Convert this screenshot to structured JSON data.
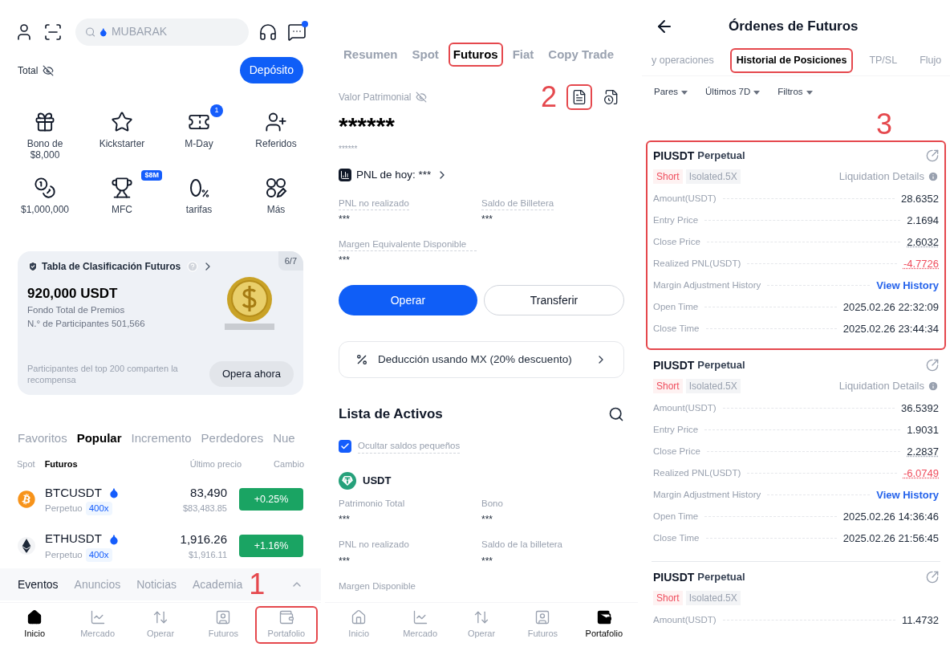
{
  "home": {
    "search": {
      "placeholder": "MUBARAK"
    },
    "total": "Total",
    "deposit": "Depósito",
    "shortcuts": [
      {
        "kind": "gift",
        "label": "Bono de $8,000"
      },
      {
        "kind": "star",
        "label": "Kickstarter"
      },
      {
        "kind": "ticket",
        "label": "M-Day",
        "badge": {
          "kind": "dot",
          "text": "1"
        }
      },
      {
        "kind": "referral",
        "label": "Referidos"
      },
      {
        "kind": "coins",
        "label": "$1,000,000"
      },
      {
        "kind": "trophy",
        "label": "MFC",
        "badge": {
          "kind": "tag",
          "text": "$8M"
        }
      },
      {
        "kind": "zero-fee",
        "label": "tarifas"
      },
      {
        "kind": "more",
        "label": "Más"
      }
    ],
    "leaderboard": {
      "title": "Tabla de Clasificación Futuros",
      "pager": "6/7",
      "amount": "920,000 USDT",
      "subtitle": "Fondo Total de Premios",
      "participants": "N.° de Participantes 501,566",
      "note": "Participantes del top 200 comparten la recompensa",
      "button": "Opera ahora"
    },
    "market_tabs": [
      {
        "label": "Favoritos",
        "selected": false
      },
      {
        "label": "Popular",
        "selected": true
      },
      {
        "label": "Incremento",
        "selected": false
      },
      {
        "label": "Perdedores",
        "selected": false
      },
      {
        "label": "Nue",
        "selected": false
      }
    ],
    "market_type_tabs": [
      {
        "label": "Spot",
        "selected": false
      },
      {
        "label": "Futuros",
        "selected": true
      }
    ],
    "columns": [
      "Último precio",
      "Cambio"
    ],
    "rows": [
      {
        "kind": "btc",
        "symbol": "BTCUSDT",
        "type": "Perpetuo",
        "leverage": "400x",
        "price": "83,490",
        "fiat_price": "$83,483.85",
        "change": "+0.25%"
      },
      {
        "kind": "eth",
        "symbol": "ETHUSDT",
        "type": "Perpetuo",
        "leverage": "400x",
        "price": "1,916.26",
        "fiat_price": "$1,916.11",
        "change": "+1.16%"
      }
    ],
    "news_tabs": [
      {
        "label": "Eventos",
        "selected": true
      },
      {
        "label": "Anuncios",
        "selected": false
      },
      {
        "label": "Noticias",
        "selected": false
      },
      {
        "label": "Academia",
        "selected": false
      }
    ],
    "marker": "1",
    "nav": [
      {
        "kind": "home",
        "label": "Inicio",
        "selected": true,
        "highlighted": false
      },
      {
        "kind": "market",
        "label": "Mercado",
        "selected": false,
        "highlighted": false
      },
      {
        "kind": "trade",
        "label": "Operar",
        "selected": false,
        "highlighted": false
      },
      {
        "kind": "futures",
        "label": "Futuros",
        "selected": false,
        "highlighted": false
      },
      {
        "kind": "portfolio",
        "label": "Portafolio",
        "selected": false,
        "highlighted": true
      }
    ]
  },
  "portfolio": {
    "tabs": [
      {
        "label": "Resumen",
        "selected": false,
        "highlighted": false
      },
      {
        "label": "Spot",
        "selected": false,
        "highlighted": false
      },
      {
        "label": "Futuros",
        "selected": true,
        "highlighted": true
      },
      {
        "label": "Fiat",
        "selected": false,
        "highlighted": false
      },
      {
        "label": "Copy Trade",
        "selected": false,
        "highlighted": false
      }
    ],
    "equity_label": "Valor Patrimonial",
    "marker": "2",
    "actions": [
      {
        "kind": "orders",
        "highlighted": true
      },
      {
        "kind": "history",
        "highlighted": false
      }
    ],
    "equity": "******",
    "equity_sub": "******",
    "pnl_today": "PNL de hoy: ***",
    "stats": [
      {
        "label": "PNL no realizado",
        "value": "***"
      },
      {
        "label": "Saldo de Billetera",
        "value": "***"
      },
      {
        "label": "Margen Equivalente Disponible",
        "value": "***"
      }
    ],
    "buttons": [
      {
        "kind": "primary",
        "label": "Operar"
      },
      {
        "kind": "secondary",
        "label": "Transferir"
      }
    ],
    "deduction": "Deducción usando MX (20% descuento)",
    "assets_title": "Lista de Activos",
    "hide_small": {
      "label": "Ocultar saldos pequeños",
      "checked": true
    },
    "asset": {
      "symbol": "USDT",
      "fields": [
        {
          "label": "Patrimonio Total",
          "value": "***"
        },
        {
          "label": "Bono",
          "value": "***"
        },
        {
          "label": "PNL no realizado",
          "value": "***"
        },
        {
          "label": "Saldo de la billetera",
          "value": "***"
        },
        {
          "label": "Margen Disponible"
        }
      ]
    },
    "nav": [
      {
        "kind": "home",
        "label": "Inicio",
        "selected": false,
        "highlighted": false
      },
      {
        "kind": "market",
        "label": "Mercado",
        "selected": false,
        "highlighted": false
      },
      {
        "kind": "trade",
        "label": "Operar",
        "selected": false,
        "highlighted": false
      },
      {
        "kind": "futures",
        "label": "Futuros",
        "selected": false,
        "highlighted": false
      },
      {
        "kind": "portfolio",
        "label": "Portafolio",
        "selected": true,
        "highlighted": false
      }
    ]
  },
  "orders": {
    "title": "Órdenes de Futuros",
    "tabs": [
      {
        "label": "y operaciones",
        "selected": false,
        "highlighted": false
      },
      {
        "label": "Historial de Posiciones",
        "selected": true,
        "highlighted": true
      },
      {
        "label": "TP/SL",
        "selected": false,
        "highlighted": false
      },
      {
        "label": "Flujo",
        "selected": false,
        "highlighted": false
      }
    ],
    "filters": [
      "Pares",
      "Últimos 7D",
      "Filtros"
    ],
    "marker": "3",
    "positions": [
      {
        "symbol": "PIUSDT",
        "contract": "Perpetual",
        "side": "Short",
        "margin": "Isolated.5X",
        "liquidation": "Liquidation Details",
        "highlighted": true,
        "rows": [
          {
            "label": "Amount(USDT)",
            "value": "28.6352",
            "kind": "plain"
          },
          {
            "label": "Entry Price",
            "value": "2.1694",
            "kind": "plain"
          },
          {
            "label": "Close Price",
            "value": "2.6032",
            "kind": "dotted"
          },
          {
            "label": "Realized PNL(USDT)",
            "value": "-4.7726",
            "kind": "negative"
          },
          {
            "label": "Margin Adjustment History",
            "value": "View History",
            "kind": "link"
          },
          {
            "label": "Open Time",
            "value": "2025.02.26 22:32:09",
            "kind": "plain"
          },
          {
            "label": "Close Time",
            "value": "2025.02.26 23:44:34",
            "kind": "plain"
          }
        ]
      },
      {
        "symbol": "PIUSDT",
        "contract": "Perpetual",
        "side": "Short",
        "margin": "Isolated.5X",
        "liquidation": "Liquidation Details",
        "highlighted": false,
        "rows": [
          {
            "label": "Amount(USDT)",
            "value": "36.5392",
            "kind": "plain"
          },
          {
            "label": "Entry Price",
            "value": "1.9031",
            "kind": "plain"
          },
          {
            "label": "Close Price",
            "value": "2.2837",
            "kind": "dotted"
          },
          {
            "label": "Realized PNL(USDT)",
            "value": "-6.0749",
            "kind": "negative"
          },
          {
            "label": "Margin Adjustment History",
            "value": "View History",
            "kind": "link"
          },
          {
            "label": "Open Time",
            "value": "2025.02.26 14:36:46",
            "kind": "plain"
          },
          {
            "label": "Close Time",
            "value": "2025.02.26 21:56:45",
            "kind": "plain"
          }
        ]
      },
      {
        "symbol": "PIUSDT",
        "contract": "Perpetual",
        "side": "Short",
        "margin": "Isolated.5X",
        "highlighted": false,
        "rows": [
          {
            "label": "Amount(USDT)",
            "value": "11.4732",
            "kind": "plain"
          }
        ]
      }
    ]
  }
}
